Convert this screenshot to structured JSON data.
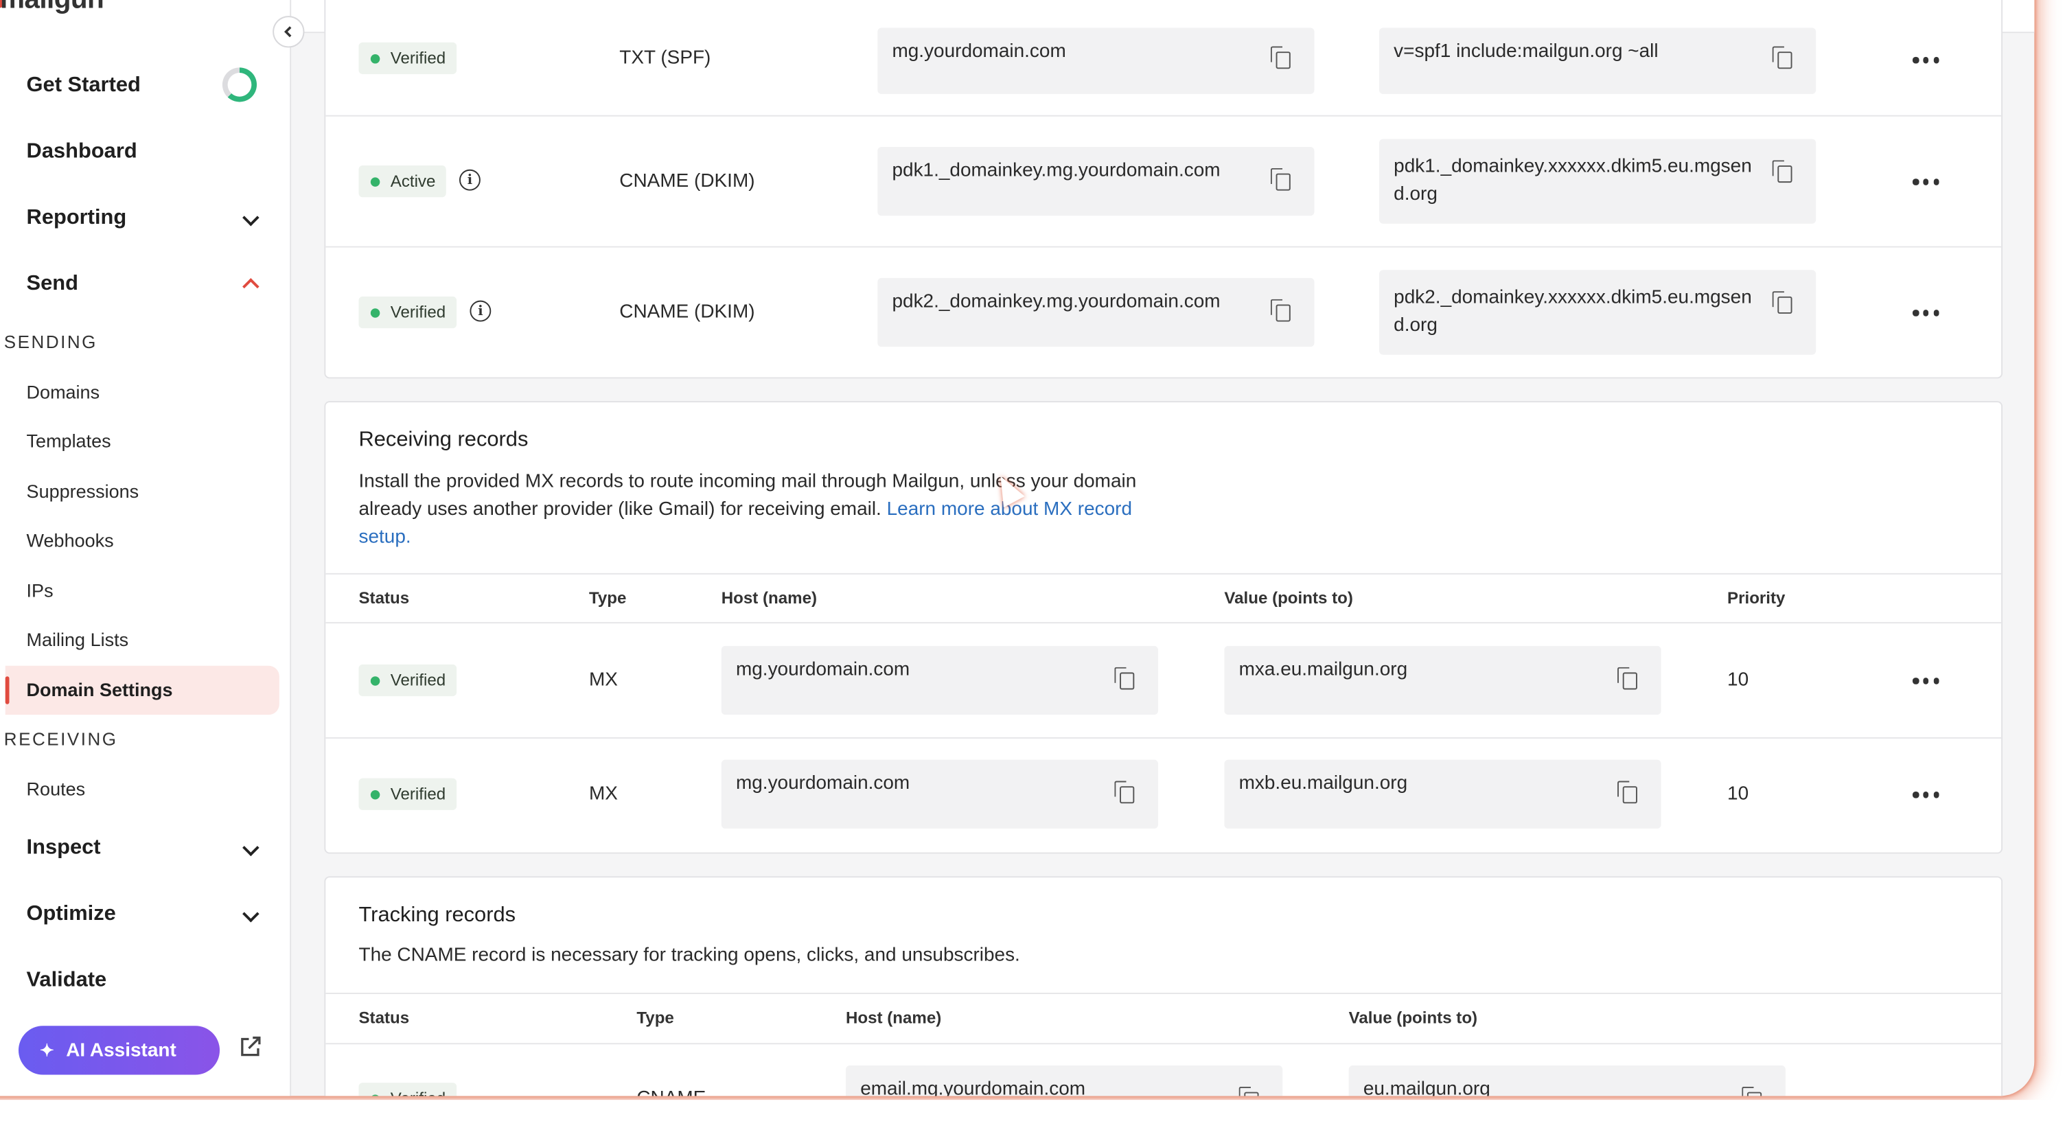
{
  "app": {
    "logo": "mailgun"
  },
  "sidebar": {
    "main_items": [
      {
        "label": "Get Started"
      },
      {
        "label": "Dashboard"
      },
      {
        "label": "Reporting"
      },
      {
        "label": "Send"
      }
    ],
    "sections": {
      "sending": "SENDING",
      "receiving": "RECEIVING"
    },
    "sending_items": [
      "Domains",
      "Templates",
      "Suppressions",
      "Webhooks",
      "IPs",
      "Mailing Lists",
      "Domain Settings"
    ],
    "receiving_items": [
      "Routes"
    ],
    "lower_items": [
      "Inspect",
      "Optimize",
      "Validate"
    ],
    "ai_assistant": "AI Assistant",
    "active_item": "Domain Settings"
  },
  "sending_records": {
    "rows": [
      {
        "status": "Verified",
        "type": "TXT (SPF)",
        "host": "mg.yourdomain.com",
        "value": "v=spf1 include:mailgun.org ~all"
      },
      {
        "status": "Active",
        "type": "CNAME (DKIM)",
        "host": "pdk1._domainkey.mg.yourdomain.com",
        "value_line1": "pdk1._domainkey.xxxxxx.dkim5.eu.mgsen",
        "value_line2": "d.org"
      },
      {
        "status": "Verified",
        "type": "CNAME (DKIM)",
        "host": "pdk2._domainkey.mg.yourdomain.com",
        "value_line1": "pdk2._domainkey.xxxxxx.dkim5.eu.mgsen",
        "value_line2": "d.org"
      }
    ]
  },
  "receiving_records": {
    "title": "Receiving records",
    "desc_line1": "Install the provided MX records to route incoming mail through Mailgun, unless your domain",
    "desc_line2_pre": "already uses another provider (like Gmail) for receiving email. ",
    "link_part1": "Learn more about MX record",
    "link_part2": "setup.",
    "columns": {
      "status": "Status",
      "type": "Type",
      "host": "Host (name)",
      "value": "Value (points to)",
      "priority": "Priority"
    },
    "rows": [
      {
        "status": "Verified",
        "type": "MX",
        "host": "mg.yourdomain.com",
        "value": "mxa.eu.mailgun.org",
        "priority": "10"
      },
      {
        "status": "Verified",
        "type": "MX",
        "host": "mg.yourdomain.com",
        "value": "mxb.eu.mailgun.org",
        "priority": "10"
      }
    ]
  },
  "tracking_records": {
    "title": "Tracking records",
    "desc": "The CNAME record is necessary for tracking opens, clicks, and unsubscribes.",
    "columns": {
      "status": "Status",
      "type": "Type",
      "host": "Host (name)",
      "value": "Value (points to)"
    },
    "rows": [
      {
        "status": "Verified",
        "type": "CNAME",
        "host": "email.mg.yourdomain.com",
        "value": "eu.mailgun.org"
      }
    ]
  }
}
